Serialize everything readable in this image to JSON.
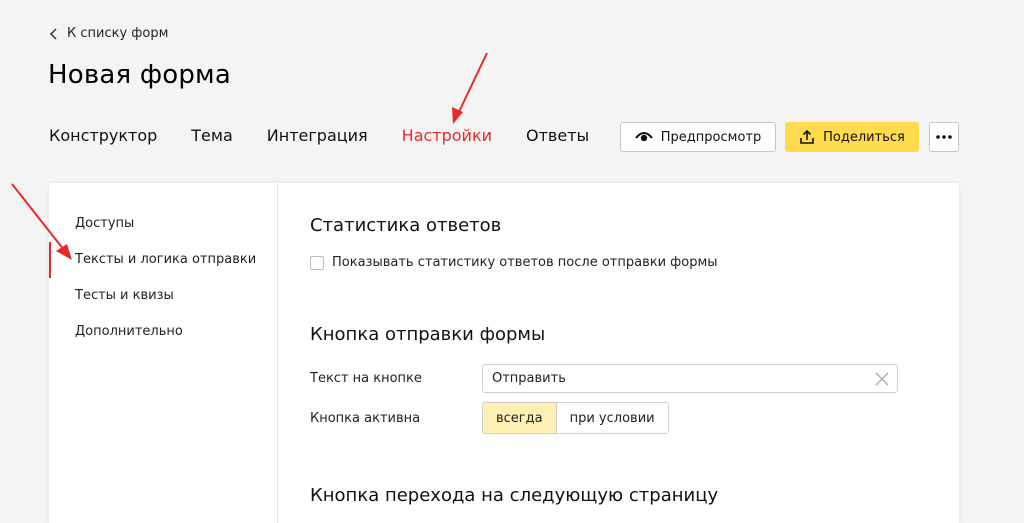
{
  "back_link": {
    "label": "К списку форм",
    "icon": "chevron-left-icon"
  },
  "page_title": "Новая форма",
  "tabs": [
    {
      "label": "Конструктор"
    },
    {
      "label": "Тема"
    },
    {
      "label": "Интеграция"
    },
    {
      "label": "Настройки",
      "active": true
    },
    {
      "label": "Ответы"
    }
  ],
  "toolbar": {
    "preview_label": "Предпросмотр",
    "share_label": "Поделиться",
    "more_icon": "more-dots-icon"
  },
  "sidebar": {
    "items": [
      {
        "label": "Доступы"
      },
      {
        "label": "Тексты и логика отправки",
        "active": true
      },
      {
        "label": "Тесты и квизы"
      },
      {
        "label": "Дополнительно"
      }
    ]
  },
  "stats_section": {
    "title": "Статистика ответов",
    "checkbox_label": "Показывать статистику ответов после отправки формы",
    "checked": false
  },
  "submit_section": {
    "title": "Кнопка отправки формы",
    "text_label": "Текст на кнопке",
    "text_value": "Отправить",
    "active_label": "Кнопка активна",
    "options": [
      "всегда",
      "при условии"
    ],
    "selected": "всегда"
  },
  "next_section": {
    "title": "Кнопка перехода на следующую страницу"
  },
  "colors": {
    "accent_red": "#e52a2a",
    "share_yellow": "#ffdb4d",
    "selected_segment": "#fff1b3"
  }
}
